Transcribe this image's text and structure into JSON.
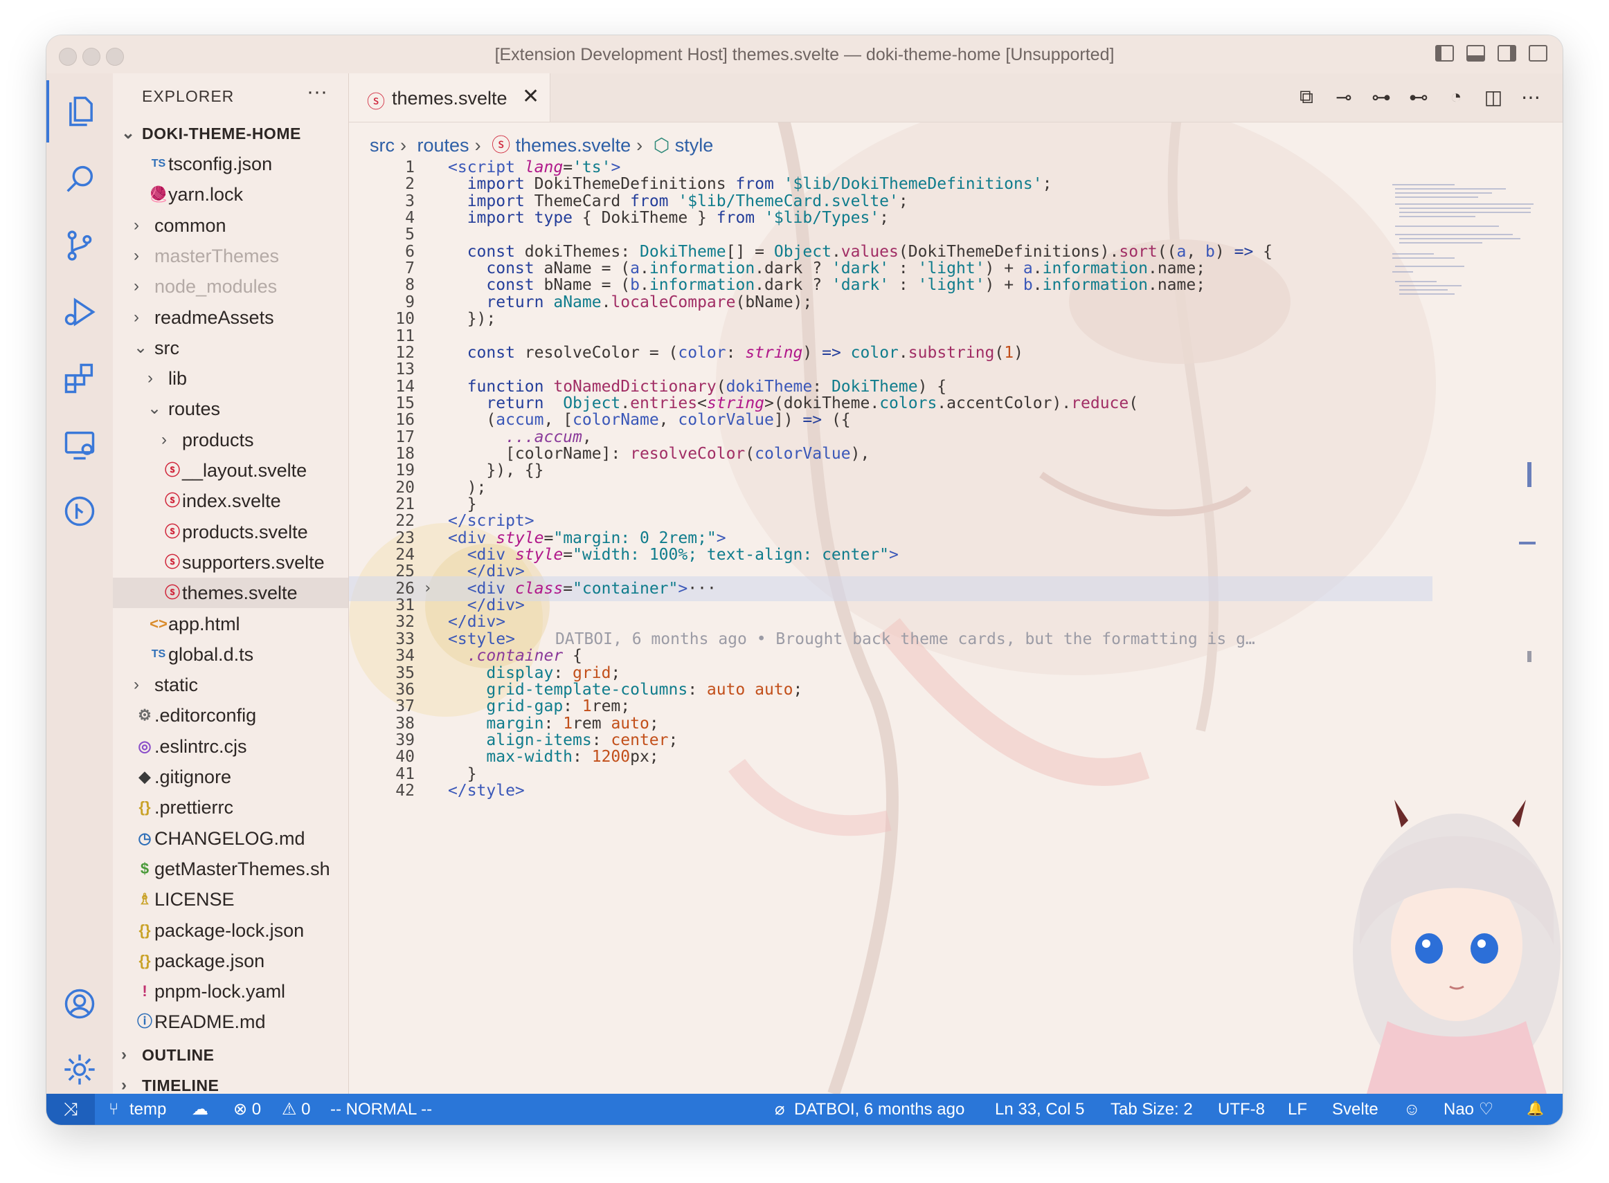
{
  "window": {
    "title": "[Extension Development Host] themes.svelte — doki-theme-home [Unsupported]"
  },
  "activity_bar": {
    "items": [
      "explorer-icon",
      "search-icon",
      "source-control-icon",
      "run-debug-icon",
      "extensions-icon",
      "remote-explorer-icon",
      "git-graph-icon"
    ],
    "bottom": [
      "account-icon",
      "settings-gear-icon"
    ]
  },
  "sidebar": {
    "header": "EXPLORER",
    "more": "···",
    "root": "DOKI-THEME-HOME",
    "tree": [
      {
        "label": "tsconfig.json",
        "icon": "TS",
        "depth": 1,
        "type": "file"
      },
      {
        "label": "yarn.lock",
        "icon": "🧶",
        "depth": 1,
        "type": "file"
      },
      {
        "label": "common",
        "depth": 0,
        "type": "folder"
      },
      {
        "label": "masterThemes",
        "depth": 0,
        "type": "folder",
        "dim": true
      },
      {
        "label": "node_modules",
        "depth": 0,
        "type": "folder",
        "dim": true
      },
      {
        "label": "readmeAssets",
        "depth": 0,
        "type": "folder"
      },
      {
        "label": "src",
        "depth": 0,
        "type": "folder",
        "open": true
      },
      {
        "label": "lib",
        "depth": 1,
        "type": "folder"
      },
      {
        "label": "routes",
        "depth": 1,
        "type": "folder",
        "open": true
      },
      {
        "label": "products",
        "depth": 2,
        "type": "folder"
      },
      {
        "label": "__layout.svelte",
        "icon": "S",
        "depth": 2,
        "type": "file"
      },
      {
        "label": "index.svelte",
        "icon": "S",
        "depth": 2,
        "type": "file"
      },
      {
        "label": "products.svelte",
        "icon": "S",
        "depth": 2,
        "type": "file"
      },
      {
        "label": "supporters.svelte",
        "icon": "S",
        "depth": 2,
        "type": "file"
      },
      {
        "label": "themes.svelte",
        "icon": "S",
        "depth": 2,
        "type": "file",
        "selected": true
      },
      {
        "label": "app.html",
        "icon": "<>",
        "depth": 1,
        "type": "file"
      },
      {
        "label": "global.d.ts",
        "icon": "TS",
        "depth": 1,
        "type": "file"
      },
      {
        "label": "static",
        "depth": 0,
        "type": "folder"
      },
      {
        "label": ".editorconfig",
        "icon": "⚙",
        "depth": 0,
        "type": "file"
      },
      {
        "label": ".eslintrc.cjs",
        "icon": "◎",
        "depth": 0,
        "type": "file"
      },
      {
        "label": ".gitignore",
        "icon": "◆",
        "depth": 0,
        "type": "file"
      },
      {
        "label": ".prettierrc",
        "icon": "{}",
        "depth": 0,
        "type": "file"
      },
      {
        "label": "CHANGELOG.md",
        "icon": "◷",
        "depth": 0,
        "type": "file"
      },
      {
        "label": "getMasterThemes.sh",
        "icon": "$",
        "depth": 0,
        "type": "file"
      },
      {
        "label": "LICENSE",
        "icon": "♗",
        "depth": 0,
        "type": "file"
      },
      {
        "label": "package-lock.json",
        "icon": "{}",
        "depth": 0,
        "type": "file"
      },
      {
        "label": "package.json",
        "icon": "{}",
        "depth": 0,
        "type": "file"
      },
      {
        "label": "pnpm-lock.yaml",
        "icon": "!",
        "depth": 0,
        "type": "file"
      },
      {
        "label": "README.md",
        "icon": "ⓘ",
        "depth": 0,
        "type": "file"
      }
    ],
    "sections": [
      "OUTLINE",
      "TIMELINE"
    ]
  },
  "editor": {
    "tab": {
      "label": "themes.svelte",
      "close": "✕"
    },
    "actions": [
      "open-changes-icon",
      "git-compare-icon",
      "previous-change-icon",
      "next-change-icon",
      "timeline-icon",
      "split-editor-icon",
      "more-actions-icon"
    ],
    "breadcrumb": [
      "src",
      "routes",
      "themes.svelte",
      "style"
    ],
    "blame": "DATBOI, 6 months ago • Brought back theme cards, but the formatting is g…",
    "lines": [
      {
        "n": "1",
        "html": "<span class='p'>&lt;script</span> <span class='t'>lang</span>=<span class='s'>'ts'</span><span class='p'>&gt;</span>"
      },
      {
        "n": "2",
        "html": "  <span class='k'>import</span> DokiThemeDefinitions <span class='k'>from</span> <span class='s'>'$lib/DokiThemeDefinitions'</span>;"
      },
      {
        "n": "3",
        "html": "  <span class='k'>import</span> ThemeCard <span class='k'>from</span> <span class='s'>'$lib/ThemeCard.svelte'</span>;"
      },
      {
        "n": "4",
        "html": "  <span class='k'>import type</span> { DokiTheme } <span class='k'>from</span> <span class='s'>'$lib/Types'</span>;"
      },
      {
        "n": "5",
        "html": ""
      },
      {
        "n": "6",
        "html": "  <span class='k'>const</span> dokiThemes: <span class='s'>DokiTheme</span>[] = <span class='s'>Object</span>.<span class='f'>values</span>(DokiThemeDefinitions).<span class='f'>sort</span>((<span class='p'>a</span>, <span class='p'>b</span>) <span class='k'>=&gt;</span> {"
      },
      {
        "n": "7",
        "html": "    <span class='k'>const</span> aName = (<span class='p'>a</span>.<span class='s'>information</span>.dark ? <span class='s'>'dark'</span> : <span class='s'>'light'</span>) + <span class='p'>a</span>.<span class='s'>information</span>.name;"
      },
      {
        "n": "8",
        "html": "    <span class='k'>const</span> bName = (<span class='p'>b</span>.<span class='s'>information</span>.dark ? <span class='s'>'dark'</span> : <span class='s'>'light'</span>) + <span class='p'>b</span>.<span class='s'>information</span>.name;"
      },
      {
        "n": "9",
        "html": "    <span class='k'>return</span> <span class='s'>aName</span>.<span class='f'>localeCompare</span>(bName);"
      },
      {
        "n": "10",
        "html": "  });"
      },
      {
        "n": "11",
        "html": ""
      },
      {
        "n": "12",
        "html": "  <span class='k'>const</span> resolveColor = (<span class='p'>color</span>: <span class='t'>string</span>) <span class='k'>=&gt;</span> <span class='s'>color</span>.<span class='f'>substring</span>(<span class='n'>1</span>)"
      },
      {
        "n": "13",
        "html": ""
      },
      {
        "n": "14",
        "html": "  <span class='k'>function</span> <span class='f'>toNamedDictionary</span>(<span class='p'>dokiTheme</span>: <span class='s'>DokiTheme</span>) {"
      },
      {
        "n": "15",
        "html": "    <span class='k'>return</span>  <span class='s'>Object</span>.<span class='f'>entries</span>&lt;<span class='t'>string</span>&gt;(dokiTheme.<span class='s'>colors</span>.accentColor).<span class='f'>reduce</span>("
      },
      {
        "n": "16",
        "html": "    (<span class='p'>accum</span>, [<span class='p'>colorName</span>, <span class='p'>colorValue</span>]) <span class='k'>=&gt;</span> ({"
      },
      {
        "n": "17",
        "html": "      <span class='c'>...accum</span>,"
      },
      {
        "n": "18",
        "html": "      [colorName]: <span class='f'>resolveColor</span>(<span class='p'>colorValue</span>),"
      },
      {
        "n": "19",
        "html": "    }), {}"
      },
      {
        "n": "20",
        "html": "  );"
      },
      {
        "n": "21",
        "html": "  }"
      },
      {
        "n": "22",
        "html": "<span class='p'>&lt;/script&gt;</span>"
      },
      {
        "n": "23",
        "html": "<span class='p'>&lt;div</span> <span class='t'>style</span>=<span class='s'>\"margin: 0 2rem;\"</span><span class='p'>&gt;</span>"
      },
      {
        "n": "24",
        "html": "  <span class='p'>&lt;div</span> <span class='t'>style</span>=<span class='s'>\"width: 100%; text-align: center\"</span><span class='p'>&gt;</span>"
      },
      {
        "n": "25",
        "html": "  <span class='p'>&lt;/div&gt;</span>"
      },
      {
        "n": "26",
        "html": "  <span class='p'>&lt;div</span> <span class='t'>class</span>=<span class='s'>\"container\"</span><span class='p'>&gt;</span>···",
        "hl": true,
        "fold": "›"
      },
      {
        "n": "31",
        "html": "  <span class='p'>&lt;/div&gt;</span>"
      },
      {
        "n": "32",
        "html": "<span class='p'>&lt;/div&gt;</span>"
      },
      {
        "n": "33",
        "html": "<span class='p'>&lt;style&gt;</span>",
        "blame": true
      },
      {
        "n": "34",
        "html": "  <span class='c'>.container</span> {"
      },
      {
        "n": "35",
        "html": "    <span class='s'>display</span>: <span class='n'>grid</span>;"
      },
      {
        "n": "36",
        "html": "    <span class='s'>grid-template-columns</span>: <span class='n'>auto auto</span>;"
      },
      {
        "n": "37",
        "html": "    <span class='s'>grid-gap</span>: <span class='n'>1</span>rem;"
      },
      {
        "n": "38",
        "html": "    <span class='s'>margin</span>: <span class='n'>1</span>rem <span class='n'>auto</span>;"
      },
      {
        "n": "39",
        "html": "    <span class='s'>align-items</span>: <span class='n'>center</span>;"
      },
      {
        "n": "40",
        "html": "    <span class='s'>max-width</span>: <span class='n'>1200</span>px;"
      },
      {
        "n": "41",
        "html": "  }"
      },
      {
        "n": "42",
        "html": "<span class='p'>&lt;/style&gt;</span>"
      }
    ]
  },
  "statusbar": {
    "remote": "⤨",
    "branch": "temp",
    "sync": "☁",
    "errors": "⊗ 0",
    "warnings": "⚠ 0",
    "mode": "-- NORMAL --",
    "blame": "DATBOI, 6 months ago",
    "position": "Ln 33, Col 5",
    "tab_size": "Tab Size: 2",
    "encoding": "UTF-8",
    "eol": "LF",
    "language": "Svelte",
    "feedback": "☺",
    "user": "Nao ♡",
    "bell": "🔔"
  },
  "colors": {
    "accent": "#2a76d8",
    "tab_icon": "#d0283d",
    "background": "#f4e9e3"
  }
}
